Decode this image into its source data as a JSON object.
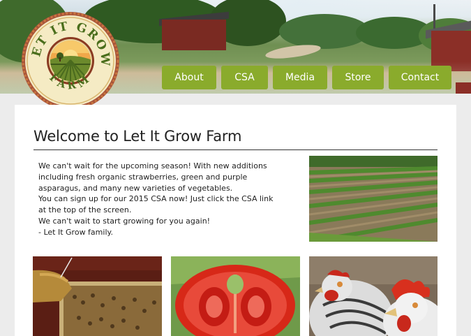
{
  "logo": {
    "text_top": "LET IT GROW",
    "text_bottom": "FARM"
  },
  "nav": {
    "items": [
      {
        "label": "About"
      },
      {
        "label": "CSA"
      },
      {
        "label": "Media"
      },
      {
        "label": "Store"
      },
      {
        "label": "Contact"
      }
    ]
  },
  "main": {
    "title": "Welcome to Let It Grow Farm",
    "paragraphs": [
      "We can't wait for the upcoming season! With new additions including fresh organic strawberries, green and purple asparagus, and many new varieties of vegetables.",
      "You can sign up for our 2015 CSA now! Just click the CSA link at the top of the screen.",
      "We can't wait to start growing for you again!",
      "- Let It Grow family."
    ]
  },
  "colors": {
    "nav_button": "#8aab2c",
    "nav_text": "#ffffff",
    "page_background": "#ececec",
    "logo_ring": "#8a3a22",
    "logo_face": "#f5ebc4"
  },
  "icons": {
    "field_photo": "farm-field-photo-icon",
    "bees_photo": "beehive-frame-photo-icon",
    "tomato_photo": "tomato-photo-icon",
    "chickens_photo": "chickens-photo-icon"
  }
}
